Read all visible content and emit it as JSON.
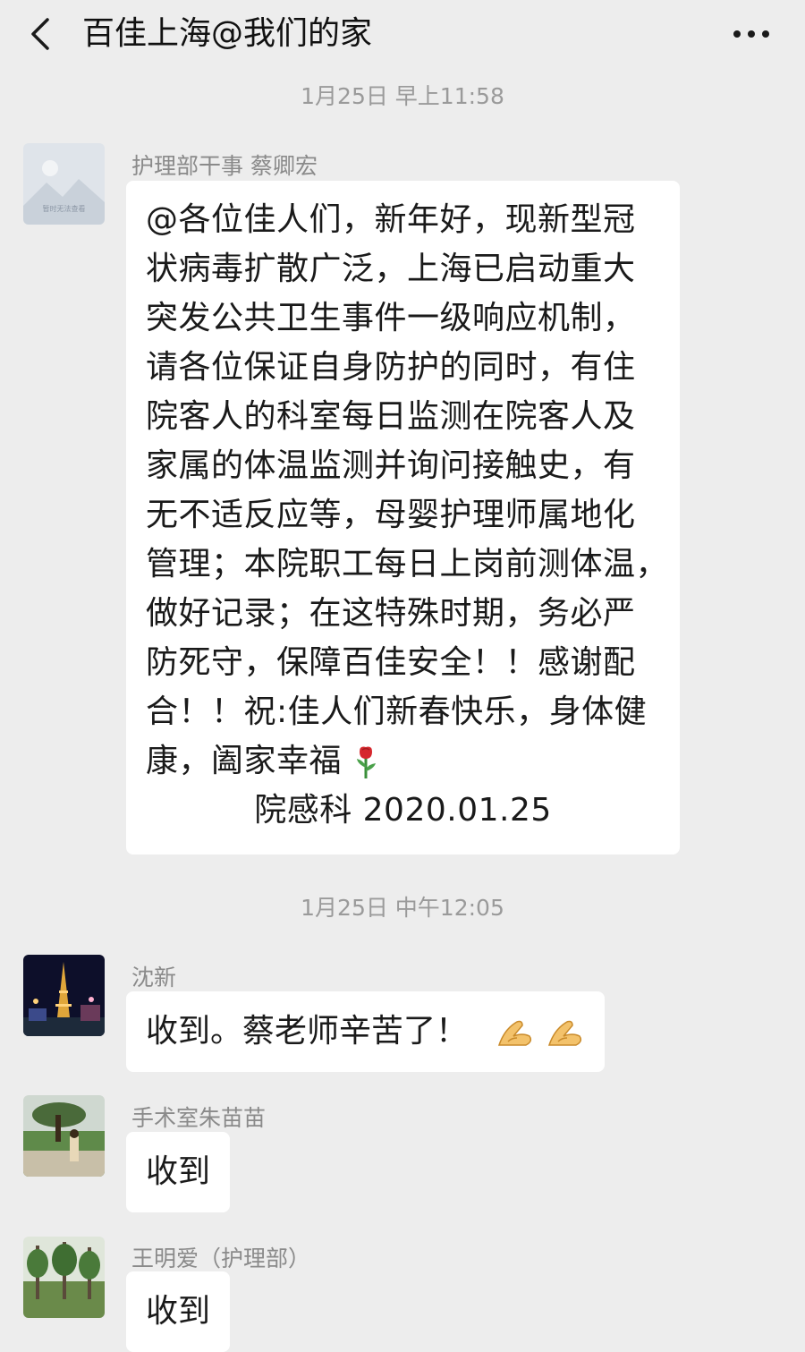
{
  "header": {
    "title": "百佳上海@我们的家",
    "back_icon": "chevron-left-icon",
    "more_icon": "more-dots-icon"
  },
  "messages_group_1": {
    "timestamp": "1月25日 早上11:58",
    "sender": "护理部干事 蔡卿宏",
    "avatar_note": "暂时无法查看",
    "lines": [
      "@各位佳人们，新年好，现新型冠",
      "状病毒扩散广泛，上海已启动重大",
      "突发公共卫生事件一级响应机制，",
      "请各位保证自身防护的同时，有住",
      "院客人的科室每日监测在院客人及",
      "家属的体温监测并询问接触史，有",
      "无不适反应等，母婴护理师属地化",
      "管理；本院职工每日上岗前测体温，",
      "做好记录；在这特殊时期，务必严",
      "防死守，保障百佳安全！！感谢配",
      "合！！祝:佳人们新春快乐，身体健",
      "康，阖家幸福"
    ],
    "signature": "院感科  2020.01.25"
  },
  "messages_group_2": {
    "timestamp": "1月25日 中午12:05",
    "msg1": {
      "sender": "沈新",
      "text": "收到。蔡老师辛苦了！"
    },
    "msg2": {
      "sender": "手术室朱苗苗",
      "text": "收到"
    },
    "msg3": {
      "sender": "王明爱（护理部）",
      "text": "收到"
    }
  },
  "colors": {
    "background": "#ededed",
    "bubble": "#ffffff",
    "meta_text": "#9a9a9a"
  }
}
